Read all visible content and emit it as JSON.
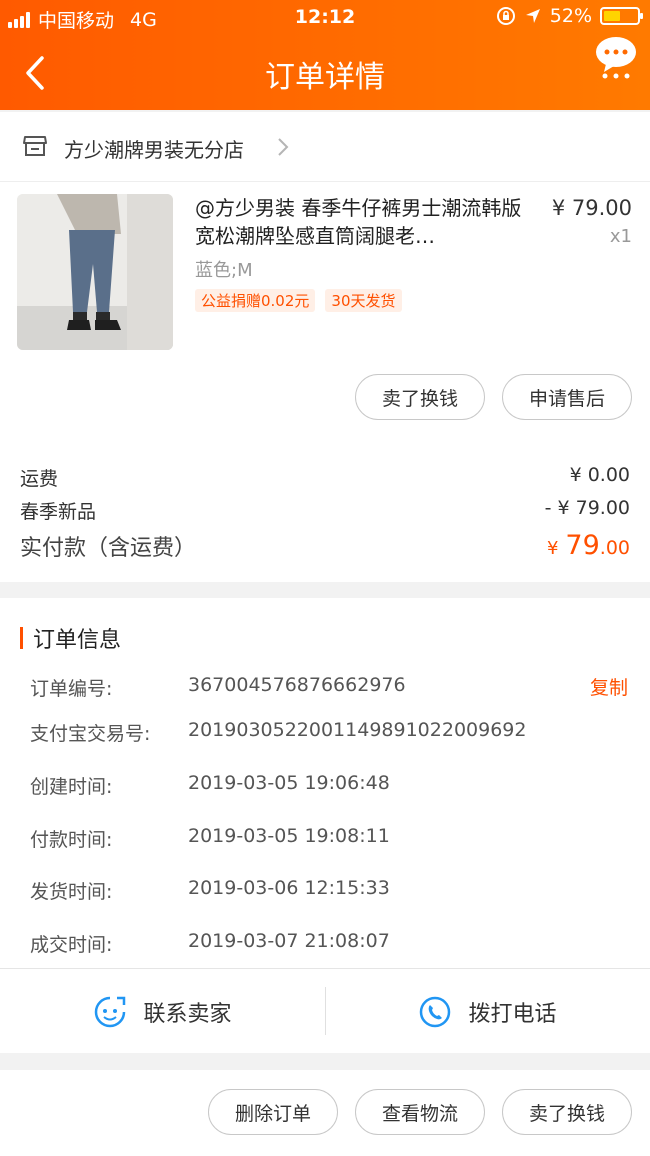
{
  "status_bar": {
    "carrier": "中国移动",
    "network": "4G",
    "time": "12:12",
    "battery": "52%"
  },
  "nav": {
    "title": "订单详情"
  },
  "shop": {
    "name": "方少潮牌男装无分店"
  },
  "product": {
    "title": "@方少男装 春季牛仔裤男士潮流韩版宽松潮牌坠感直筒阔腿老…",
    "price": "¥ 79.00",
    "quantity": "x1",
    "spec": "蓝色;M",
    "tags": [
      "公益捐赠0.02元",
      "30天发货"
    ],
    "actions": {
      "sell": "卖了换钱",
      "after_sale": "申请售后"
    }
  },
  "fees": {
    "shipping_label": "运费",
    "shipping_value": "¥ 0.00",
    "discount_label": "春季新品",
    "discount_value": "- ¥ 79.00",
    "paid_label": "实付款（含运费）",
    "paid_currency": "¥",
    "paid_int": "79",
    "paid_dec": ".00"
  },
  "order_info": {
    "title": "订单信息",
    "copy_label": "复制",
    "rows": [
      {
        "label": "订单编号:",
        "value": "367004576876662976"
      },
      {
        "label": "支付宝交易号:",
        "value": "2019030522001149891022009692"
      },
      {
        "label": "创建时间:",
        "value": "2019-03-05 19:06:48"
      },
      {
        "label": "付款时间:",
        "value": "2019-03-05 19:08:11"
      },
      {
        "label": "发货时间:",
        "value": "2019-03-06 12:15:33"
      },
      {
        "label": "成交时间:",
        "value": "2019-03-07 21:08:07"
      }
    ],
    "contact_seller": "联系卖家",
    "call_phone": "拨打电话"
  },
  "bottom_actions": {
    "delete": "删除订单",
    "logistics": "查看物流",
    "sell": "卖了换钱"
  },
  "colors": {
    "accent": "#ff5000",
    "header_start": "#ff5a00",
    "header_end": "#ff7a00",
    "contact_icon": "#2196f3"
  }
}
